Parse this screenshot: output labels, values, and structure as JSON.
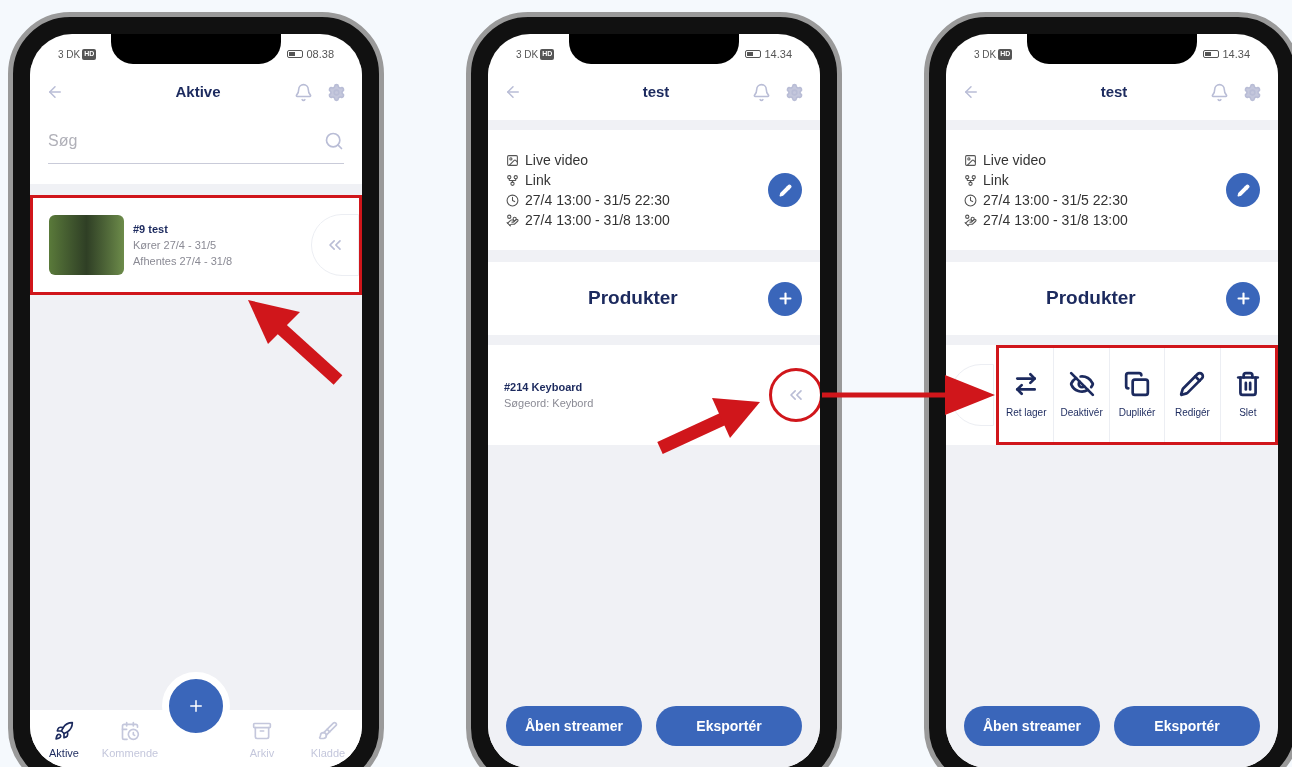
{
  "phones": [
    {
      "kind": "list",
      "status": {
        "carrier": "3 DK",
        "network": "HD",
        "time": "08.38"
      },
      "header": {
        "title": "Aktive"
      },
      "search": {
        "placeholder": "Søg"
      },
      "events": [
        {
          "title": "#9 test",
          "lines": [
            "Kører 27/4 - 31/5",
            "Afhentes 27/4 - 31/8"
          ],
          "highlighted": true
        }
      ],
      "nav": [
        {
          "label": "Aktive",
          "kind": "rocket",
          "selected": true
        },
        {
          "label": "Kommende",
          "kind": "calendar",
          "selected": false
        },
        {
          "label": "Arkiv",
          "kind": "archive",
          "selected": false
        },
        {
          "label": "Kladde",
          "kind": "brush",
          "selected": false
        }
      ]
    },
    {
      "kind": "detail",
      "status": {
        "carrier": "3 DK",
        "network": "HD",
        "time": "14.34"
      },
      "header": {
        "title": "test"
      },
      "info": [
        {
          "kind": "video",
          "text": "Live video"
        },
        {
          "kind": "link",
          "text": "Link"
        },
        {
          "kind": "period",
          "text": "27/4 13:00 - 31/5 22:30"
        },
        {
          "kind": "pickup",
          "text": "27/4 13:00 - 31/8 13:00"
        }
      ],
      "section_title": "Produkter",
      "products": [
        {
          "swiped": false,
          "highlighted": true,
          "title": "#214 Keyboard",
          "subtitle": "Søgeord: Keybord"
        }
      ],
      "buttons": [
        "Åben streamer",
        "Eksportér"
      ]
    },
    {
      "kind": "detail",
      "status": {
        "carrier": "3 DK",
        "network": "HD",
        "time": "14.34"
      },
      "header": {
        "title": "test"
      },
      "info": [
        {
          "kind": "video",
          "text": "Live video"
        },
        {
          "kind": "link",
          "text": "Link"
        },
        {
          "kind": "period",
          "text": "27/4 13:00 - 31/5 22:30"
        },
        {
          "kind": "pickup",
          "text": "27/4 13:00 - 31/8 13:00"
        }
      ],
      "section_title": "Produkter",
      "products": [
        {
          "swiped": true,
          "highlighted": true,
          "actions": [
            {
              "kind": "stock",
              "label": "Ret lager"
            },
            {
              "kind": "hide",
              "label": "Deaktivér"
            },
            {
              "kind": "copy",
              "label": "Duplikér"
            },
            {
              "kind": "edit",
              "label": "Redigér"
            },
            {
              "kind": "delete",
              "label": "Slet"
            }
          ]
        }
      ],
      "buttons": [
        "Åben streamer",
        "Eksportér"
      ]
    }
  ]
}
